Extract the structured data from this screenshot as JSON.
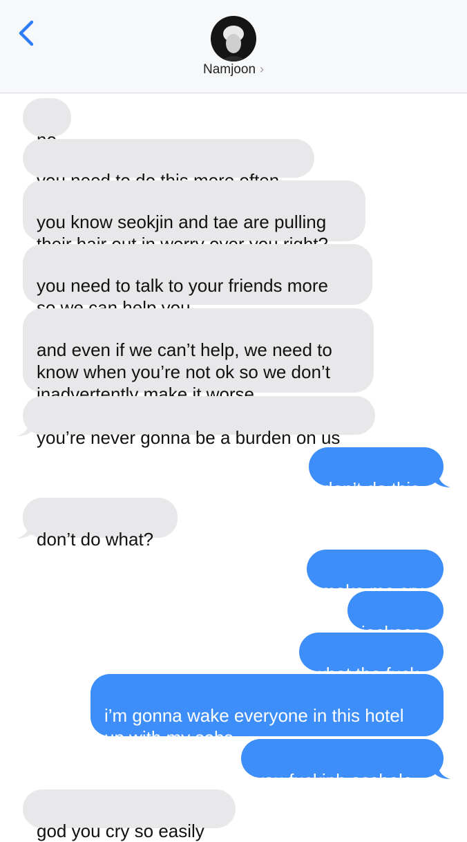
{
  "header": {
    "contact_name": "Namjoon",
    "chevron": "›",
    "back_icon": "back-chevron-icon"
  },
  "messages": [
    {
      "direction": "in",
      "text": "no"
    },
    {
      "direction": "in",
      "text": "you need to do this more often"
    },
    {
      "direction": "in",
      "text": "you know seokjin and tae are pulling\ntheir hair out in worry over you right?"
    },
    {
      "direction": "in",
      "text": "you need to talk to your friends more\nso we can help you"
    },
    {
      "direction": "in",
      "text": "and even if we can’t help, we need to\nknow when you’re not ok so we don’t\ninadvertently make it worse"
    },
    {
      "direction": "in",
      "text": "you’re never gonna be a burden on us"
    },
    {
      "direction": "out",
      "text": "don’t do this"
    },
    {
      "direction": "in",
      "text": "don’t do what?"
    },
    {
      "direction": "out",
      "text": "make me cry"
    },
    {
      "direction": "out",
      "text": "jackass"
    },
    {
      "direction": "out",
      "text": "what the fuck"
    },
    {
      "direction": "out",
      "text": "i’m gonna wake everyone in this hotel\nup with my sobs"
    },
    {
      "direction": "out",
      "text": "you fuckinh asshole,"
    },
    {
      "direction": "in",
      "text": "god you cry so easily"
    }
  ],
  "colors": {
    "incoming_bubble": "#e8e8eb",
    "outgoing_bubble": "#3d8ef8",
    "accent": "#2f7cf6"
  }
}
